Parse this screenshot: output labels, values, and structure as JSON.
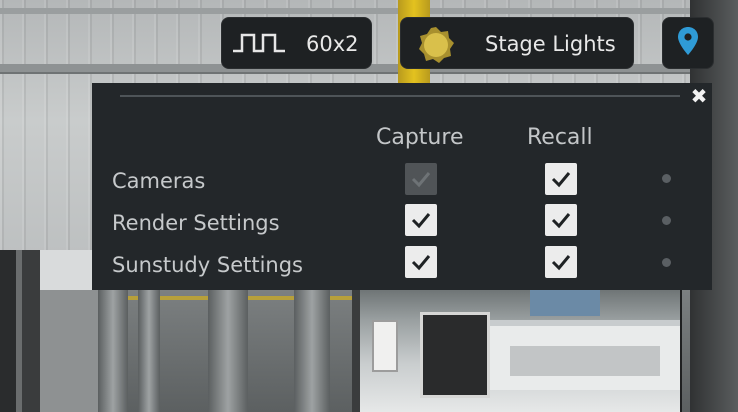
{
  "toolbar": {
    "fps_label": "60x2",
    "fps_icon": "pulse-wave-icon",
    "lights_label": "Stage Lights",
    "lights_icon": "sun-icon",
    "lights_icon_color": "#d9c04b",
    "location_icon": "map-pin-icon",
    "location_icon_color": "#2f9bd6"
  },
  "panel": {
    "close_icon": "close-icon",
    "columns": {
      "capture": "Capture",
      "recall": "Recall"
    },
    "rows": [
      {
        "label": "Cameras",
        "capture_checked": true,
        "capture_enabled": false,
        "recall_checked": true
      },
      {
        "label": "Render Settings",
        "capture_checked": true,
        "capture_enabled": true,
        "recall_checked": true
      },
      {
        "label": "Sunstudy Settings",
        "capture_checked": true,
        "capture_enabled": true,
        "recall_checked": true
      }
    ]
  },
  "colors": {
    "panel_bg": "#23272a",
    "checkbox_bg": "#ececec",
    "checkbox_disabled_bg": "#505457"
  }
}
